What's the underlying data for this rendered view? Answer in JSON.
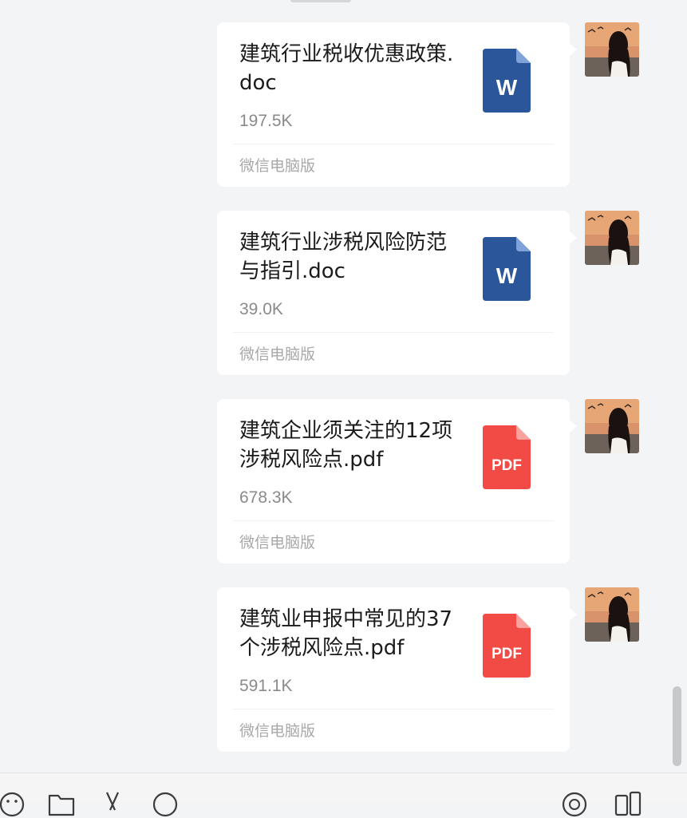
{
  "chat": {
    "messages": [
      {
        "file_name": "建筑行业税收优惠政策.doc",
        "size": "197.5K",
        "source": "微信电脑版",
        "file_type": "word",
        "icon_label": "W",
        "icon_color": "#2b579a"
      },
      {
        "file_name": "建筑行业涉税风险防范与指引.doc",
        "size": "39.0K",
        "source": "微信电脑版",
        "file_type": "word",
        "icon_label": "W",
        "icon_color": "#2b579a"
      },
      {
        "file_name": "建筑企业须关注的12项涉税风险点.pdf",
        "size": "678.3K",
        "source": "微信电脑版",
        "file_type": "pdf",
        "icon_label": "PDF",
        "icon_color": "#f24b45"
      },
      {
        "file_name": "建筑业申报中常见的37个涉税风险点.pdf",
        "size": "591.1K",
        "source": "微信电脑版",
        "file_type": "pdf",
        "icon_label": "PDF",
        "icon_color": "#f24b45"
      }
    ]
  },
  "toolbar": {
    "icons": [
      "emoji-icon",
      "folder-icon",
      "scissors-icon",
      "chat-bubble-icon",
      "history-icon",
      "video-call-icon"
    ]
  },
  "colors": {
    "background": "#f3f4f6",
    "bubble": "#ffffff",
    "word_blue": "#2b579a",
    "pdf_red": "#f24b45"
  }
}
